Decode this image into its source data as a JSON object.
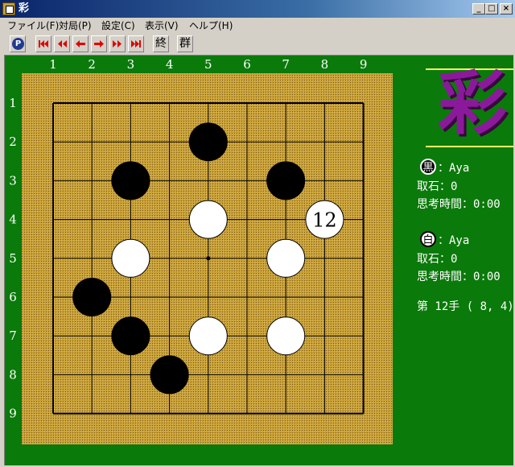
{
  "window": {
    "title": "彩"
  },
  "menu": [
    {
      "label": "ファイル(F)"
    },
    {
      "label": "対局(P)"
    },
    {
      "label": "設定(C)"
    },
    {
      "label": "表示(V)"
    },
    {
      "label": "ヘルプ(H)"
    }
  ],
  "toolbar": {
    "p_label": "P",
    "end_label": "終",
    "group_label": "群"
  },
  "board": {
    "size": 9,
    "col_labels": [
      "1",
      "2",
      "3",
      "4",
      "5",
      "6",
      "7",
      "8",
      "9"
    ],
    "row_labels": [
      "1",
      "2",
      "3",
      "4",
      "5",
      "6",
      "7",
      "8",
      "9"
    ],
    "stones": [
      {
        "col": 5,
        "row": 2,
        "color": "black"
      },
      {
        "col": 3,
        "row": 3,
        "color": "black"
      },
      {
        "col": 7,
        "row": 3,
        "color": "black"
      },
      {
        "col": 5,
        "row": 4,
        "color": "white"
      },
      {
        "col": 8,
        "row": 4,
        "color": "white",
        "label": "12"
      },
      {
        "col": 3,
        "row": 5,
        "color": "white"
      },
      {
        "col": 7,
        "row": 5,
        "color": "white"
      },
      {
        "col": 2,
        "row": 6,
        "color": "black"
      },
      {
        "col": 3,
        "row": 7,
        "color": "black"
      },
      {
        "col": 5,
        "row": 7,
        "color": "white"
      },
      {
        "col": 7,
        "row": 7,
        "color": "white"
      },
      {
        "col": 4,
        "row": 8,
        "color": "black"
      }
    ],
    "star_point": {
      "col": 5,
      "row": 5
    }
  },
  "logo": {
    "char": "彩"
  },
  "black_player": {
    "badge": "黒",
    "name": "：Aya",
    "captures": "取石：0",
    "time": "思考時間：0:00"
  },
  "white_player": {
    "badge": "白",
    "name": "：Aya",
    "captures": "取石：0",
    "time": "思考時間：0:00"
  },
  "move_info": "第 12手 ( 8, 4)",
  "colors": {
    "background_green": "#0a7a0a",
    "board_gold": "#c8a038",
    "logo_purple": "#8a1a9a",
    "logo_line": "#ffff66"
  }
}
